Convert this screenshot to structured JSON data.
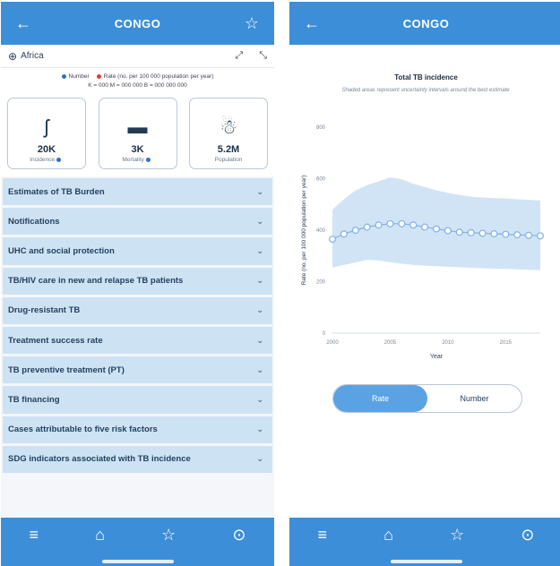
{
  "left": {
    "header": {
      "back_icon": "←",
      "title": "CONGO",
      "star_icon": "☆"
    },
    "region": {
      "label": "Africa",
      "globe_icon": "⊕",
      "expand_icon": "⤢",
      "compress_icon": "⤡"
    },
    "legend": {
      "number_label": "Number",
      "rate_label": "Rate (no. per 100 000 population per year)",
      "scale": "K = 000   M = 000 000   B = 000 000 000"
    },
    "stats": [
      {
        "value": "20K",
        "label": "Incidence",
        "icon": "ʃ"
      },
      {
        "value": "3K",
        "label": "Mortality",
        "icon": "▬"
      },
      {
        "value": "5.2M",
        "label": "Population",
        "icon": "☃"
      }
    ],
    "sections": [
      "Estimates of TB Burden",
      "Notifications",
      "UHC and social protection",
      "TB/HIV care in new and relapse TB patients",
      "Drug-resistant TB",
      "Treatment success rate",
      "TB preventive treatment (PT)",
      "TB financing",
      "Cases attributable to five risk factors",
      "SDG indicators associated with TB incidence"
    ],
    "chevron": "⌄",
    "bottom": {
      "menu_icon": "≡",
      "home_icon": "⌂",
      "star_icon": "☆",
      "more_icon": "⊙"
    }
  },
  "right": {
    "header": {
      "back_icon": "←",
      "title": "CONGO"
    },
    "toggle": {
      "rate": "Rate",
      "number": "Number",
      "active": "rate"
    },
    "bottom": {
      "menu_icon": "≡",
      "home_icon": "⌂",
      "star_icon": "☆",
      "more_icon": "⊙"
    }
  },
  "chart_data": {
    "type": "line",
    "title": "Total TB incidence",
    "subtitle": "Shaded areas represent uncertainty intervals around the best estimate",
    "xlabel": "Year",
    "ylabel": "Rate (no. per 100 000 population per year)",
    "x": [
      2000,
      2001,
      2002,
      2003,
      2004,
      2005,
      2006,
      2007,
      2008,
      2009,
      2010,
      2011,
      2012,
      2013,
      2014,
      2015,
      2016,
      2017,
      2018
    ],
    "values": [
      365,
      385,
      400,
      412,
      420,
      425,
      425,
      420,
      412,
      405,
      398,
      392,
      390,
      388,
      386,
      384,
      382,
      380,
      378
    ],
    "lower": [
      255,
      265,
      275,
      285,
      282,
      275,
      270,
      265,
      262,
      260,
      258,
      256,
      254,
      252,
      250,
      250,
      248,
      246,
      245
    ],
    "upper": [
      480,
      520,
      555,
      575,
      590,
      605,
      598,
      580,
      568,
      555,
      545,
      537,
      530,
      527,
      525,
      523,
      520,
      518,
      515
    ],
    "xlim": [
      2000,
      2018
    ],
    "ylim": [
      0,
      800
    ],
    "yticks": [
      0,
      200,
      400,
      600,
      800
    ],
    "xticks": [
      2000,
      2005,
      2010,
      2015
    ],
    "colors": {
      "line": "#7fb2e5",
      "band": "#c5ddf3"
    }
  }
}
